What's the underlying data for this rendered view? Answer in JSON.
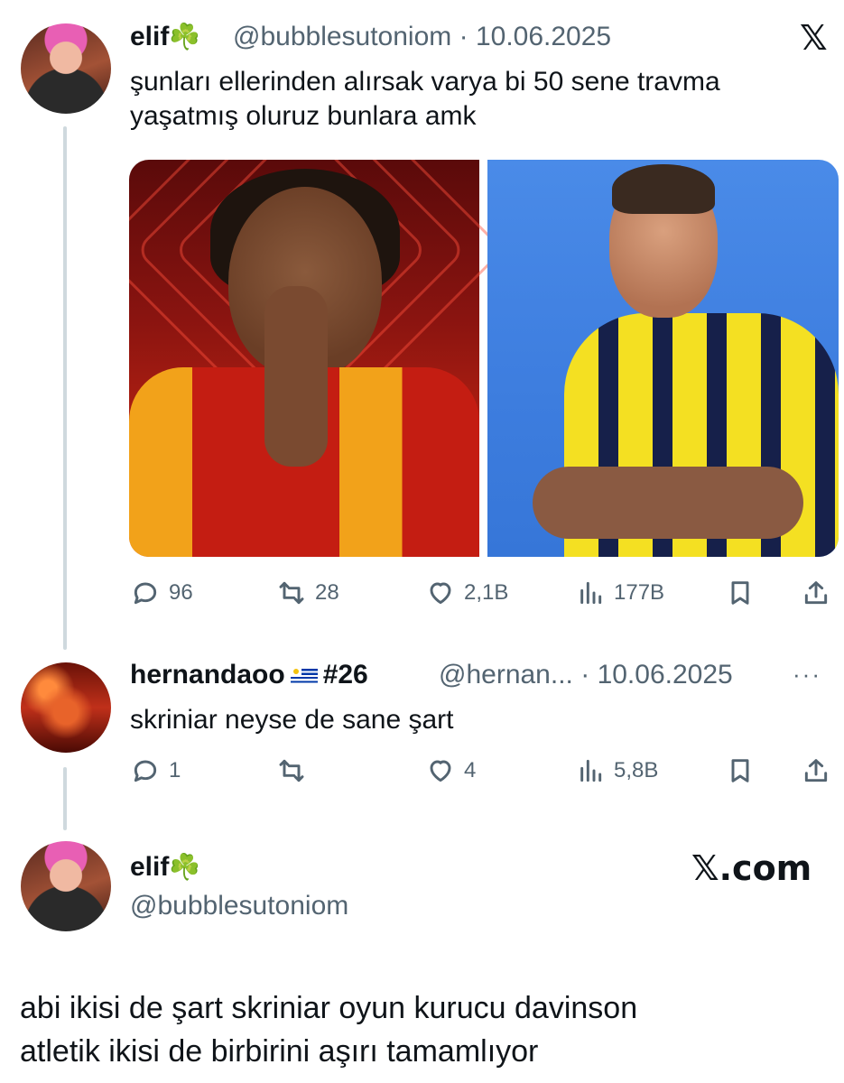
{
  "tweet1": {
    "name": "elif",
    "emoji": "☘️",
    "handle": "@bubblesutoniom",
    "separator": "·",
    "date": "10.06.2025",
    "text_line1": "şunları ellerinden alırsak varya bi 50 sene travma",
    "text_line2": "yaşatmış oluruz bunlara amk",
    "actions": {
      "reply": "96",
      "retweet": "28",
      "like": "2,1B",
      "views": "177B"
    }
  },
  "tweet2": {
    "name": "hernandaoo",
    "tag": "#26",
    "handle": "@hernan...",
    "separator": "·",
    "date": "10.06.2025",
    "more": "···",
    "text": "skriniar neyse de sane şart",
    "actions": {
      "reply": "1",
      "retweet": "",
      "like": "4",
      "views": "5,8B"
    }
  },
  "quote": {
    "name": "elif",
    "emoji": "☘️",
    "handle": "@bubblesutoniom",
    "brand": "𝕏.com"
  },
  "bottom_text_line1": "abi ikisi de şart skriniar oyun kurucu davinson",
  "bottom_text_line2": "atletik ikisi de birbirini aşırı tamamlıyor",
  "x_logo": "𝕏",
  "colors": {
    "text": "#0f1419",
    "muted": "#536471",
    "thread_line": "#cfd9de"
  }
}
